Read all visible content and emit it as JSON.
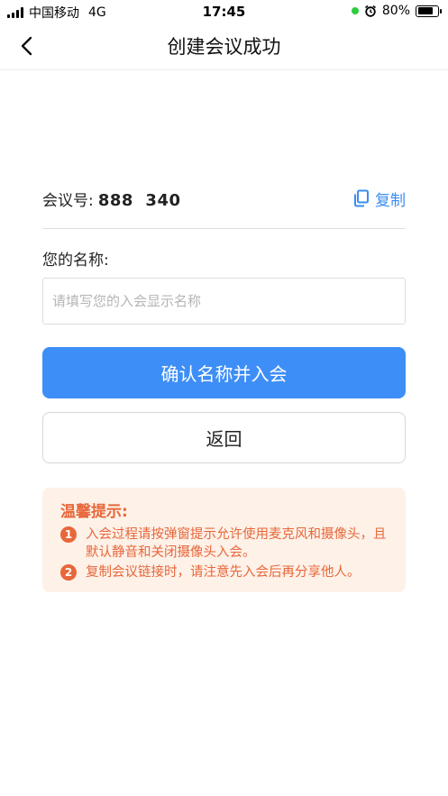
{
  "status_bar": {
    "carrier": "中国移动",
    "network": "4G",
    "time": "17:45",
    "battery_percent": "80%",
    "battery_level": 0.8
  },
  "nav": {
    "title": "创建会议成功",
    "back_icon": "chevron-left-icon"
  },
  "meeting": {
    "label": "会议号:",
    "number": "888  340",
    "copy_label": "复制",
    "copy_icon": "copy-icon"
  },
  "name_field": {
    "label": "您的名称:",
    "value": "",
    "placeholder": "请填写您的入会显示名称"
  },
  "buttons": {
    "confirm_label": "确认名称并入会",
    "return_label": "返回"
  },
  "tips": {
    "title": "温馨提示:",
    "items": [
      {
        "num": "1",
        "text": "入会过程请按弹窗提示允许使用麦克风和摄像头，且默认静音和关闭摄像头入会。"
      },
      {
        "num": "2",
        "text": "复制会议链接时，请注意先入会后再分享他人。"
      }
    ]
  },
  "colors": {
    "accent": "#3d8ef6",
    "tip_text": "#e8673a",
    "tip_background": "#fdf1e8"
  }
}
